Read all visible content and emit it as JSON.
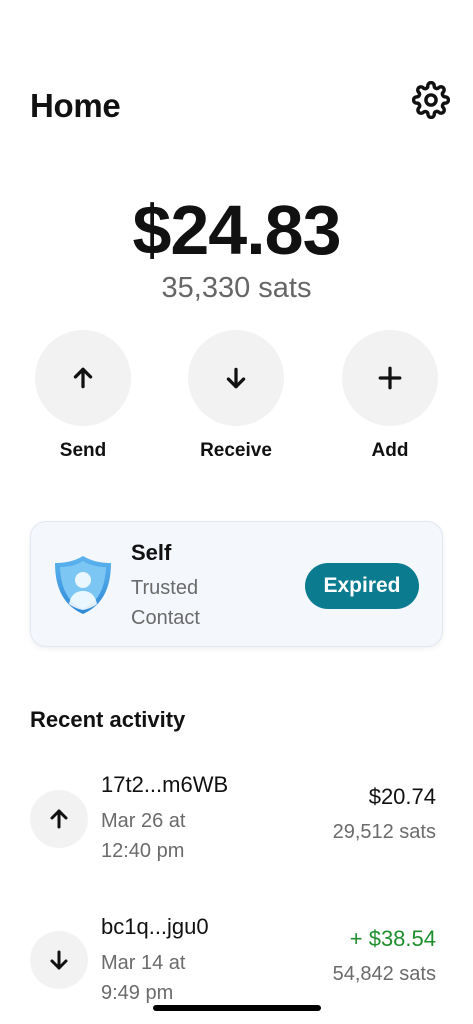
{
  "header": {
    "title": "Home",
    "settings_icon": "gear-icon"
  },
  "balance": {
    "fiat": "$24.83",
    "sats": "35,330 sats"
  },
  "actions": [
    {
      "label": "Send",
      "icon": "arrow-up-icon"
    },
    {
      "label": "Receive",
      "icon": "arrow-down-icon"
    },
    {
      "label": "Add",
      "icon": "plus-icon"
    }
  ],
  "contact_card": {
    "name": "Self",
    "description": "Trusted Contact",
    "status": "Expired",
    "icon": "shield-user-icon",
    "status_color": "#0b7c8f"
  },
  "recent_activity": {
    "title": "Recent activity",
    "items": [
      {
        "direction": "sent",
        "icon": "arrow-up-icon",
        "address": "17t2...m6WB",
        "date": "Mar 26 at 12:40 pm",
        "amount": "$20.74",
        "sats": "29,512 sats"
      },
      {
        "direction": "received",
        "icon": "arrow-down-icon",
        "address": "bc1q...jgu0",
        "date": "Mar 14 at 9:49 pm",
        "amount": "+ $38.54",
        "sats": "54,842 sats",
        "amount_color": "#1f8f2d"
      }
    ]
  }
}
